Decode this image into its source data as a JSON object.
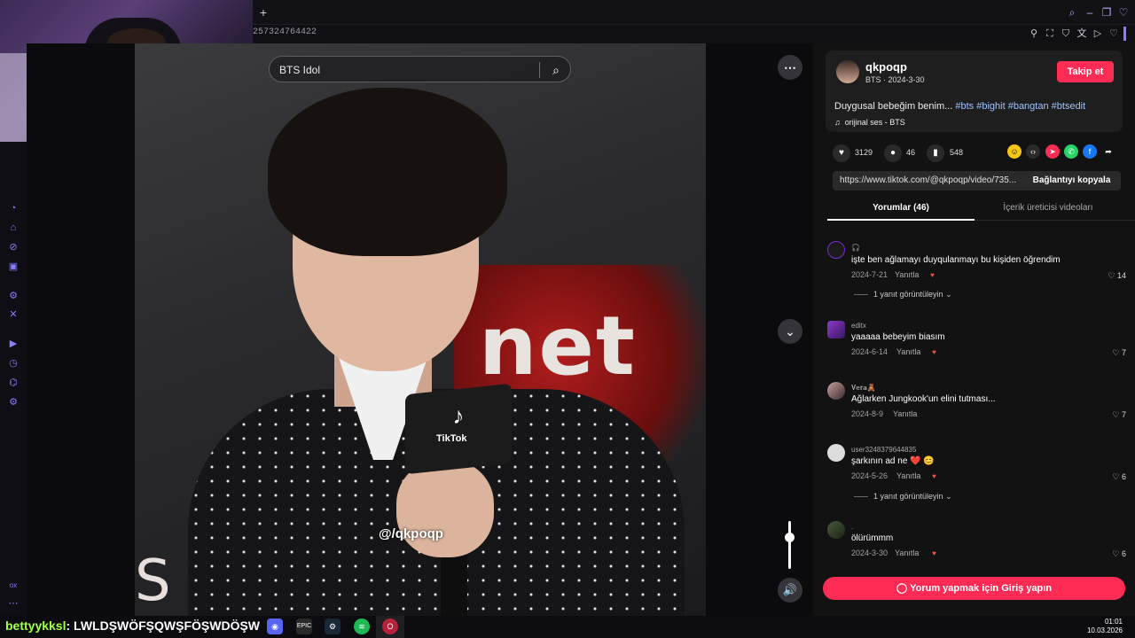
{
  "browser": {
    "new_tab": "+",
    "url": "257324764422"
  },
  "search": {
    "value": "BTS Idol"
  },
  "video": {
    "watermark": "@/qkpoqp",
    "brand_text": "net",
    "corner_text": "S",
    "mic_text": "TikTok"
  },
  "author": {
    "name": "qkpoqp",
    "meta": "BTS · 2024-3-30",
    "follow_label": "Takip et"
  },
  "description": {
    "text": "Duygusal bebeğim benim...",
    "tags": [
      "#bts",
      "#bighit",
      "#bangtan",
      "#btsedit"
    ]
  },
  "music": {
    "label": "orijinal ses - BTS"
  },
  "actions": {
    "likes": "3129",
    "comments": "46",
    "saves": "548"
  },
  "share_link": {
    "url": "https://www.tiktok.com/@qkpoqp/video/735...",
    "copy_label": "Bağlantıyı kopyala"
  },
  "tabs": {
    "comments": "Yorumlar (46)",
    "creator_videos": "İçerik üreticisi videoları"
  },
  "comments": [
    {
      "user": "🎧",
      "text": "işte ben ağlamayı duyqulanmayı bu kişiden öğrendim",
      "date": "2024-7-21",
      "reply": "Yanıtla",
      "likes": "14",
      "more": "1 yanıt görüntüleyin"
    },
    {
      "user": "editx",
      "text": "yaaaaa bebeyim biasım",
      "date": "2024-6-14",
      "reply": "Yanıtla",
      "likes": "7"
    },
    {
      "user": "𝐕𝐞𝐫𝐚🧸",
      "text": "Ağlarken Jungkook'un elini tutması...",
      "date": "2024-8-9",
      "reply": "Yanıtla",
      "likes": "7"
    },
    {
      "user": "user3248379644835",
      "text": "şarkının ad ne ❤️ 😊",
      "date": "2024-5-26",
      "reply": "Yanıtla",
      "likes": "6",
      "more": "1 yanıt görüntüleyin"
    },
    {
      "user": ".",
      "text": "ölürümmm",
      "date": "2024-3-30",
      "reply": "Yanıtla",
      "likes": "6"
    }
  ],
  "login_prompt": "Yorum yapmak için Giriş yapın",
  "taskbar": {
    "ticker_a": "bettyykksl",
    "ticker_b": ": LWLDŞWÖFŞQWŞFÖŞWDÖŞW",
    "time": "01:01",
    "date": "10.03.2026"
  },
  "colors": {
    "accent": "#fe2c55",
    "panel": "#121212",
    "tag": "#9cc3ff"
  }
}
